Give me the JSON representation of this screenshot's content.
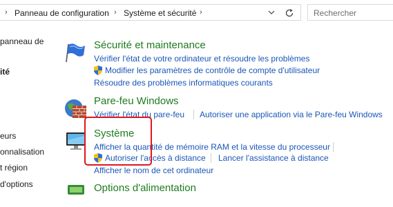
{
  "address_bar": {
    "crumbs": [
      "Panneau de configuration",
      "Système et sécurité"
    ]
  },
  "search": {
    "placeholder": "Rechercher"
  },
  "left_pane": {
    "items": [
      {
        "label": "panneau de"
      },
      {
        "label": "ité"
      },
      {
        "label": "eurs"
      },
      {
        "label": "onnalisation"
      },
      {
        "label": "t région"
      },
      {
        "label": "d'options"
      }
    ]
  },
  "categories": {
    "security": {
      "title": "Sécurité et maintenance",
      "links": [
        "Vérifier l'état de votre ordinateur et résoudre les problèmes",
        "Modifier les paramètres de contrôle de compte d'utilisateur",
        "Résoudre des problèmes informatiques courants"
      ]
    },
    "firewall": {
      "title": "Pare-feu Windows",
      "links": [
        "Vérifier l'état du pare-feu",
        "Autoriser une application via le Pare-feu Windows"
      ]
    },
    "system": {
      "title": "Système",
      "links": [
        "Afficher la quantité de mémoire RAM et la vitesse du processeur",
        "Autoriser l'accès à distance",
        "Lancer l'assistance à distance",
        "Afficher le nom de cet ordinateur"
      ]
    },
    "power": {
      "title": "Options d'alimentation"
    }
  },
  "colors": {
    "category_title": "#1f7b1f",
    "link": "#1a56b7",
    "highlight": "#e0161b"
  },
  "icons": {
    "security": "flag-icon",
    "firewall": "brick-wall-icon",
    "system": "computer-icon",
    "uac": "shield-icon"
  }
}
